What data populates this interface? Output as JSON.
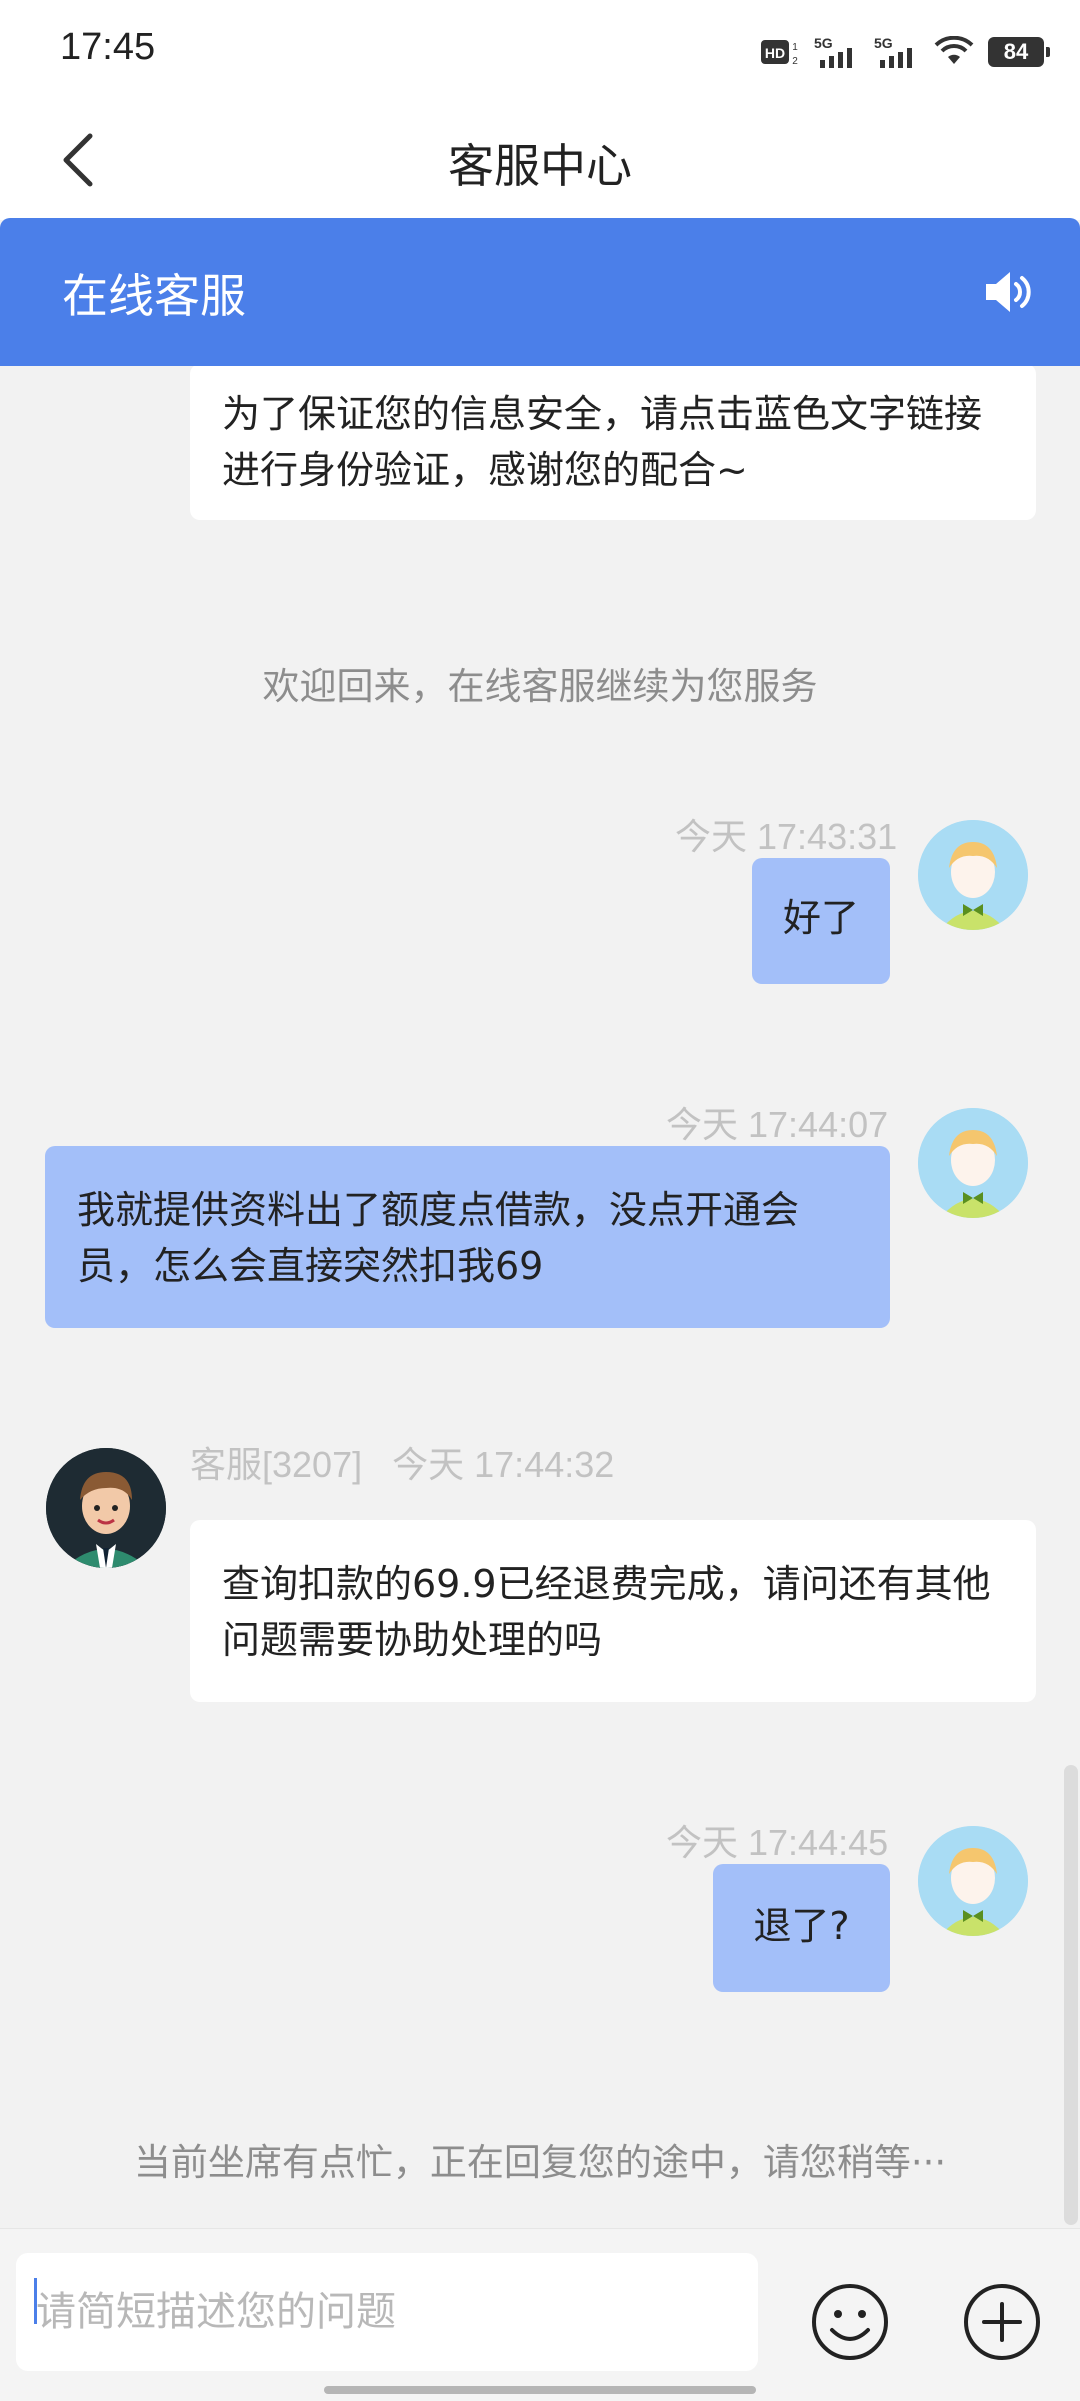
{
  "status_bar": {
    "time": "17:45",
    "battery": "84",
    "hd_label": "HD",
    "net1": "5G",
    "net2": "5G"
  },
  "title_bar": {
    "title": "客服中心",
    "back_icon": "chevron-left-icon"
  },
  "header": {
    "label": "在线客服",
    "speaker_icon": "speaker-icon",
    "color": "#4b7fe9"
  },
  "messages": [
    {
      "type": "agent",
      "text": "为了保证您的信息安全，请点击蓝色文字链接进行身份验证，感谢您的配合~"
    },
    {
      "type": "system",
      "text": "欢迎回来，在线客服继续为您服务"
    },
    {
      "type": "user",
      "time": "今天 17:43:31",
      "text": "好了"
    },
    {
      "type": "user",
      "time": "今天 17:44:07",
      "text": "我就提供资料出了额度点借款，没点开通会员，怎么会直接突然扣我69"
    },
    {
      "type": "agent",
      "agent_name": "客服[3207]",
      "time": "今天 17:44:32",
      "text": "查询扣款的69.9已经退费完成，请问还有其他问题需要协助处理的吗"
    },
    {
      "type": "user",
      "time": "今天 17:44:45",
      "text": "退了?"
    },
    {
      "type": "system",
      "text": "当前坐席有点忙，正在回复您的途中，请您稍等···"
    }
  ],
  "input_bar": {
    "placeholder": "请简短描述您的问题",
    "emoji_icon": "smiley-icon",
    "plus_icon": "plus-circle-icon"
  },
  "colors": {
    "user_bubble": "#a3bff9",
    "agent_bubble": "#ffffff",
    "background": "#f2f2f2"
  }
}
